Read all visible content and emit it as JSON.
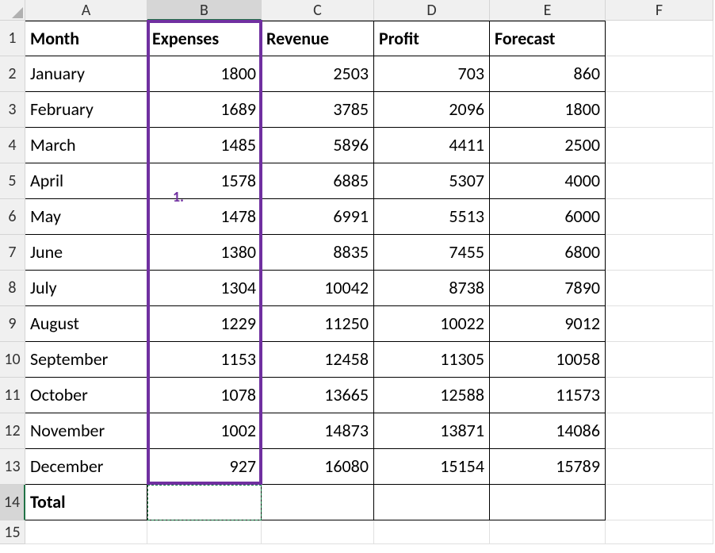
{
  "columns": [
    "A",
    "B",
    "C",
    "D",
    "E",
    "F"
  ],
  "rows": [
    "1",
    "2",
    "3",
    "4",
    "5",
    "6",
    "7",
    "8",
    "9",
    "10",
    "11",
    "12",
    "13",
    "14",
    "15"
  ],
  "headers": {
    "A1": "Month",
    "B1": "Expenses",
    "C1": "Revenue",
    "D1": "Profit",
    "E1": "Forecast"
  },
  "data": [
    {
      "month": "January",
      "expenses": "1800",
      "revenue": "2503",
      "profit": "703",
      "forecast": "860"
    },
    {
      "month": "February",
      "expenses": "1689",
      "revenue": "3785",
      "profit": "2096",
      "forecast": "1800"
    },
    {
      "month": "March",
      "expenses": "1485",
      "revenue": "5896",
      "profit": "4411",
      "forecast": "2500"
    },
    {
      "month": "April",
      "expenses": "1578",
      "revenue": "6885",
      "profit": "5307",
      "forecast": "4000"
    },
    {
      "month": "May",
      "expenses": "1478",
      "revenue": "6991",
      "profit": "5513",
      "forecast": "6000"
    },
    {
      "month": "June",
      "expenses": "1380",
      "revenue": "8835",
      "profit": "7455",
      "forecast": "6800"
    },
    {
      "month": "July",
      "expenses": "1304",
      "revenue": "10042",
      "profit": "8738",
      "forecast": "7890"
    },
    {
      "month": "August",
      "expenses": "1229",
      "revenue": "11250",
      "profit": "10022",
      "forecast": "9012"
    },
    {
      "month": "September",
      "expenses": "1153",
      "revenue": "12458",
      "profit": "11305",
      "forecast": "10058"
    },
    {
      "month": "October",
      "expenses": "1078",
      "revenue": "13665",
      "profit": "12588",
      "forecast": "11573"
    },
    {
      "month": "November",
      "expenses": "1002",
      "revenue": "14873",
      "profit": "13871",
      "forecast": "14086"
    },
    {
      "month": "December",
      "expenses": "927",
      "revenue": "16080",
      "profit": "15154",
      "forecast": "15789"
    }
  ],
  "total_label": "Total",
  "annotation": "1.",
  "selection": {
    "col": "B",
    "startRow": 1,
    "endRow": 13
  },
  "active_cell": "B14"
}
